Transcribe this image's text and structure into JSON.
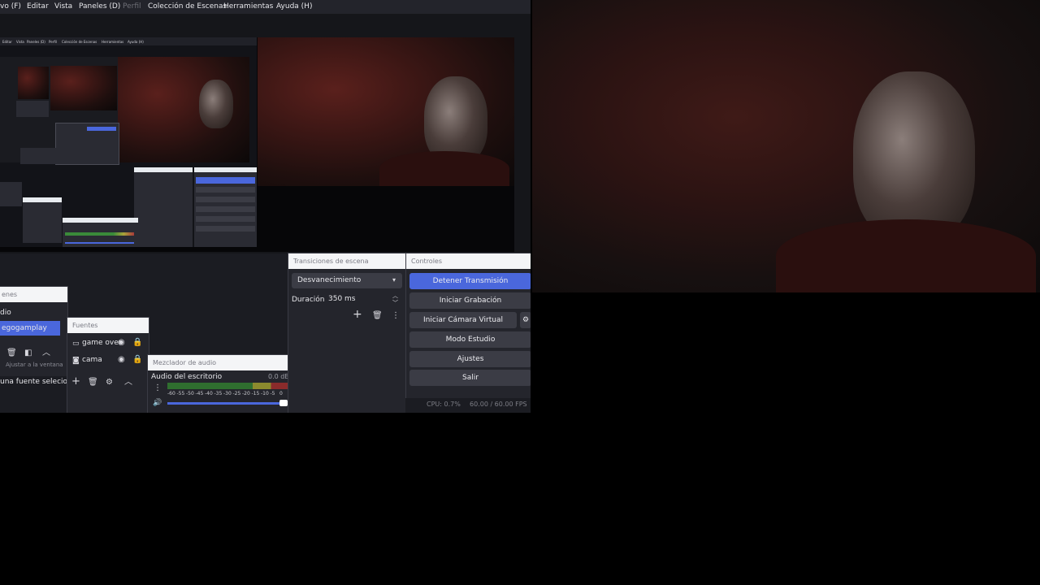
{
  "menubar": {
    "items": [
      "vo (F)",
      "Editar",
      "Vista",
      "Paneles (D)",
      "Perfil",
      "Colección de Escenas",
      "Herramientas",
      "Ayuda (H)"
    ]
  },
  "nested": {
    "menu": [
      "Editar",
      "Vista",
      "Paneles (D)",
      "Perfil",
      "Colección de Escenas",
      "Herramientas",
      "Ayuda (H)"
    ]
  },
  "scenes": {
    "title": "enes",
    "items": [
      "dio",
      "egogamplay"
    ]
  },
  "sources": {
    "title": "Fuentes",
    "items": [
      "game over",
      "cama"
    ],
    "empty_hint": "una fuente selecion",
    "tooltip": "Ajustar a la ventana"
  },
  "mixer": {
    "title": "Mezclador de audio",
    "channel_label": "Audio del escritorio",
    "db_value": "0.0 dB",
    "scale": [
      "-60",
      "-55",
      "-50",
      "-45",
      "-40",
      "-35",
      "-30",
      "-25",
      "-20",
      "-15",
      "-10",
      "-5",
      "0"
    ],
    "volume_fraction": 1.0
  },
  "transitions": {
    "title": "Transiciones de escena",
    "selected": "Desvanecimiento",
    "duration_label": "Duración",
    "duration_value": "350 ms"
  },
  "controls": {
    "title": "Controles",
    "stop_stream": "Detener Transmisión",
    "start_recording": "Iniciar Grabación",
    "start_virtual_cam": "Iniciar Cámara Virtual",
    "studio_mode": "Modo Estudio",
    "settings": "Ajustes",
    "exit": "Salir"
  },
  "status": {
    "cpu": "CPU: 0.7%",
    "fps": "60.00 / 60.00 FPS"
  },
  "icons": {
    "add": "plus-icon",
    "remove": "trash-icon",
    "settings": "gear-icon",
    "up": "chevron-up-icon",
    "visible": "eye-icon",
    "lock": "lock-icon"
  },
  "colors": {
    "accent": "#4a67dc",
    "panel": "#24252c",
    "background": "#1b1c22"
  }
}
